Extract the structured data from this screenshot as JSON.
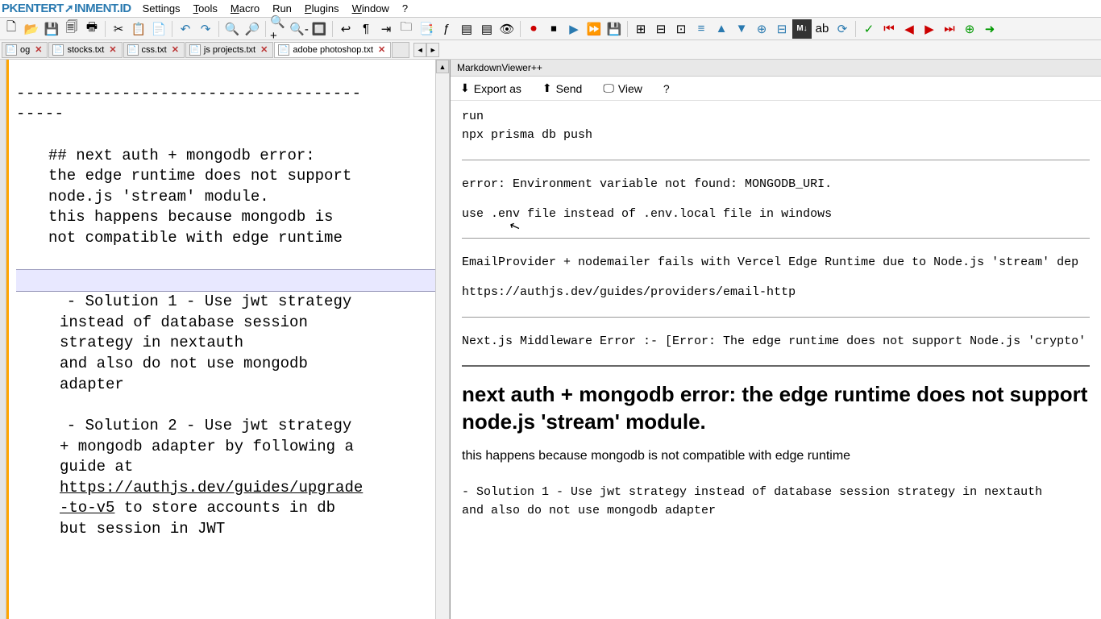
{
  "logo_text": "PKENTERT  INMENT.ID",
  "menu": {
    "settings": "Settings",
    "tools": "Tools",
    "macro": "Macro",
    "run": "Run",
    "plugins": "Plugins",
    "window": "Window",
    "help": "?"
  },
  "tabs": [
    {
      "label": "og",
      "active": false
    },
    {
      "label": "stocks.txt",
      "active": false
    },
    {
      "label": "css.txt",
      "active": false
    },
    {
      "label": "js projects.txt",
      "active": false
    },
    {
      "label": "adobe photoshop.txt",
      "active": true
    }
  ],
  "editor": {
    "hr_line1": "------------------------------------",
    "hr_line2": "-----",
    "heading": "##  next auth + mongodb error:",
    "p1_l1": "the edge runtime does not support",
    "p1_l2": "node.js 'stream' module.",
    "p1_l3": "this happens because mongodb is",
    "p1_l4": "not compatible with edge runtime",
    "blank": " ",
    "s1_l1": "  - Solution 1 - Use jwt strategy",
    "s1_l2": "instead of database session",
    "s1_l3": "strategy in nextauth",
    "s1_l4": "and also do not use mongodb",
    "s1_l5": "adapter",
    "s2_l1": "  - Solution 2 - Use jwt strategy",
    "s2_l2": "+ mongodb adapter by following a",
    "s2_l3": "guide at",
    "s2_url1": "https://authjs.dev/guides/upgrade",
    "s2_url2": "-to-v5",
    "s2_l4": " to store accounts in db",
    "s2_l5": "but session in JWT"
  },
  "preview": {
    "panel_title": "MarkdownViewer++",
    "toolbar": {
      "export": "Export as",
      "send": "Send",
      "view": "View",
      "help": "?"
    },
    "t1": "run",
    "t2": "npx prisma db push",
    "err1": "error: Environment variable not found: MONGODB_URI.",
    "err2": "use .env file instead of .env.local file in windows",
    "email": "EmailProvider + nodemailer fails with Vercel Edge Runtime due to Node.js 'stream' dep",
    "email_url": "https://authjs.dev/guides/providers/email-http",
    "mw": "Next.js Middleware Error :- [Error: The edge runtime does not support Node.js 'crypto'",
    "h2": "next auth + mongodb error: the edge runtime does not support node.js 'stream' module.",
    "p_sans": "this happens because mongodb is not compatible with edge runtime",
    "sol1_l1": "- Solution 1 - Use jwt strategy instead of database session strategy in nextauth",
    "sol1_l2": "and also do not use mongodb adapter"
  },
  "icons": {
    "new": "🗋",
    "open": "📂",
    "save": "💾",
    "saveall": "🗐",
    "print": "🖶",
    "cut": "✂",
    "copy": "📋",
    "paste": "📄",
    "undo": "↶",
    "redo": "↷",
    "find": "🔍",
    "replace": "🔎",
    "zoomin": "🔍+",
    "zoomout": "🔍-",
    "zoom1": "🔲",
    "wrap": "↩",
    "chars": "¶",
    "indent": "⇥",
    "lang": "🗀",
    "doc": "📑",
    "func": "ƒ",
    "fold": "▤",
    "eye": "👁",
    "rec": "⏺",
    "stop": "⏹",
    "play": "▶",
    "ff": "⏩",
    "save2": "💾",
    "t1": "⊞",
    "t2": "⊟",
    "t3": "⊡",
    "t4": "≡",
    "up": "▲",
    "down": "▼",
    "t5": "⊕",
    "t6": "⊟",
    "md": "M↓",
    "ab": "ab",
    "sync": "⟳",
    "g1": "✓",
    "g2": "⏮",
    "g3": "◀",
    "g4": "▶",
    "g5": "⏭",
    "g6": "⊕",
    "g7": "➜"
  }
}
